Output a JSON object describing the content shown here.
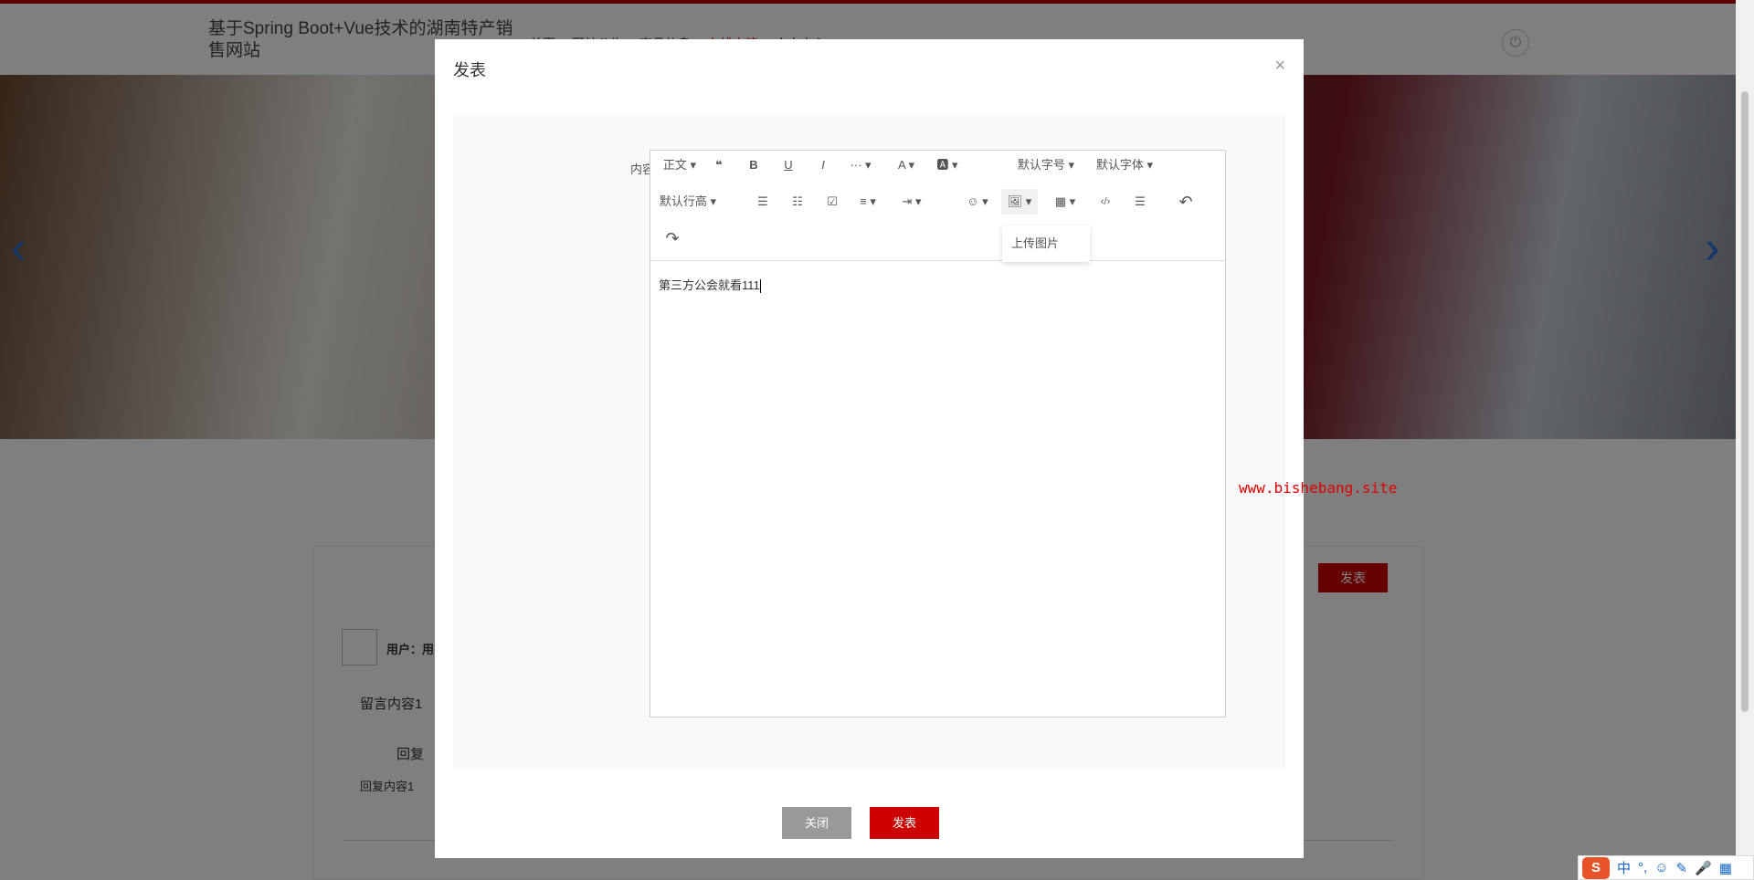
{
  "header": {
    "site_title": "基于Spring Boot+Vue技术的湖南特产销售网站",
    "nav": [
      "首页",
      "网站公告",
      "商品信息",
      "在线交流",
      "个人中心"
    ],
    "power_icon": "⏻"
  },
  "banner": {
    "prev": "‹",
    "next": "›"
  },
  "background": {
    "post_button": "发表",
    "user_label": "用户：用",
    "message": "留言内容1",
    "reply_label": "回复",
    "reply_content": "回复内容1"
  },
  "modal": {
    "title": "发表",
    "close": "×",
    "field_label": "内容",
    "toolbar": {
      "paragraph": "正文 ▾",
      "quote": "❝",
      "bold": "B",
      "underline": "U",
      "italic": "I",
      "more": "··· ▾",
      "font_color": "A ▾",
      "bg_color": "🅰 ▾",
      "font_size": "默认字号 ▾",
      "font_family": "默认字体 ▾",
      "line_height": "默认行高 ▾",
      "bullet_list": "☰",
      "numbered_list": "☷",
      "todo": "☑",
      "align": "≡ ▾",
      "indent": "⇥ ▾",
      "emoji": "☺ ▾",
      "image": "🖼 ▾",
      "table": "▦ ▾",
      "code": "‹/›",
      "divider": "☰",
      "undo": "↶",
      "redo": "↷"
    },
    "image_menu": {
      "upload": "上传图片"
    },
    "content": "第三方公会就看111",
    "watermark": "www.bishebang.site",
    "close_button": "关闭",
    "submit_button": "发表"
  },
  "ime": {
    "logo": "S",
    "mode": "中",
    "punct": "°,",
    "emoji": "☺",
    "pen": "✎",
    "mic": "🎤",
    "grid": "▦"
  }
}
